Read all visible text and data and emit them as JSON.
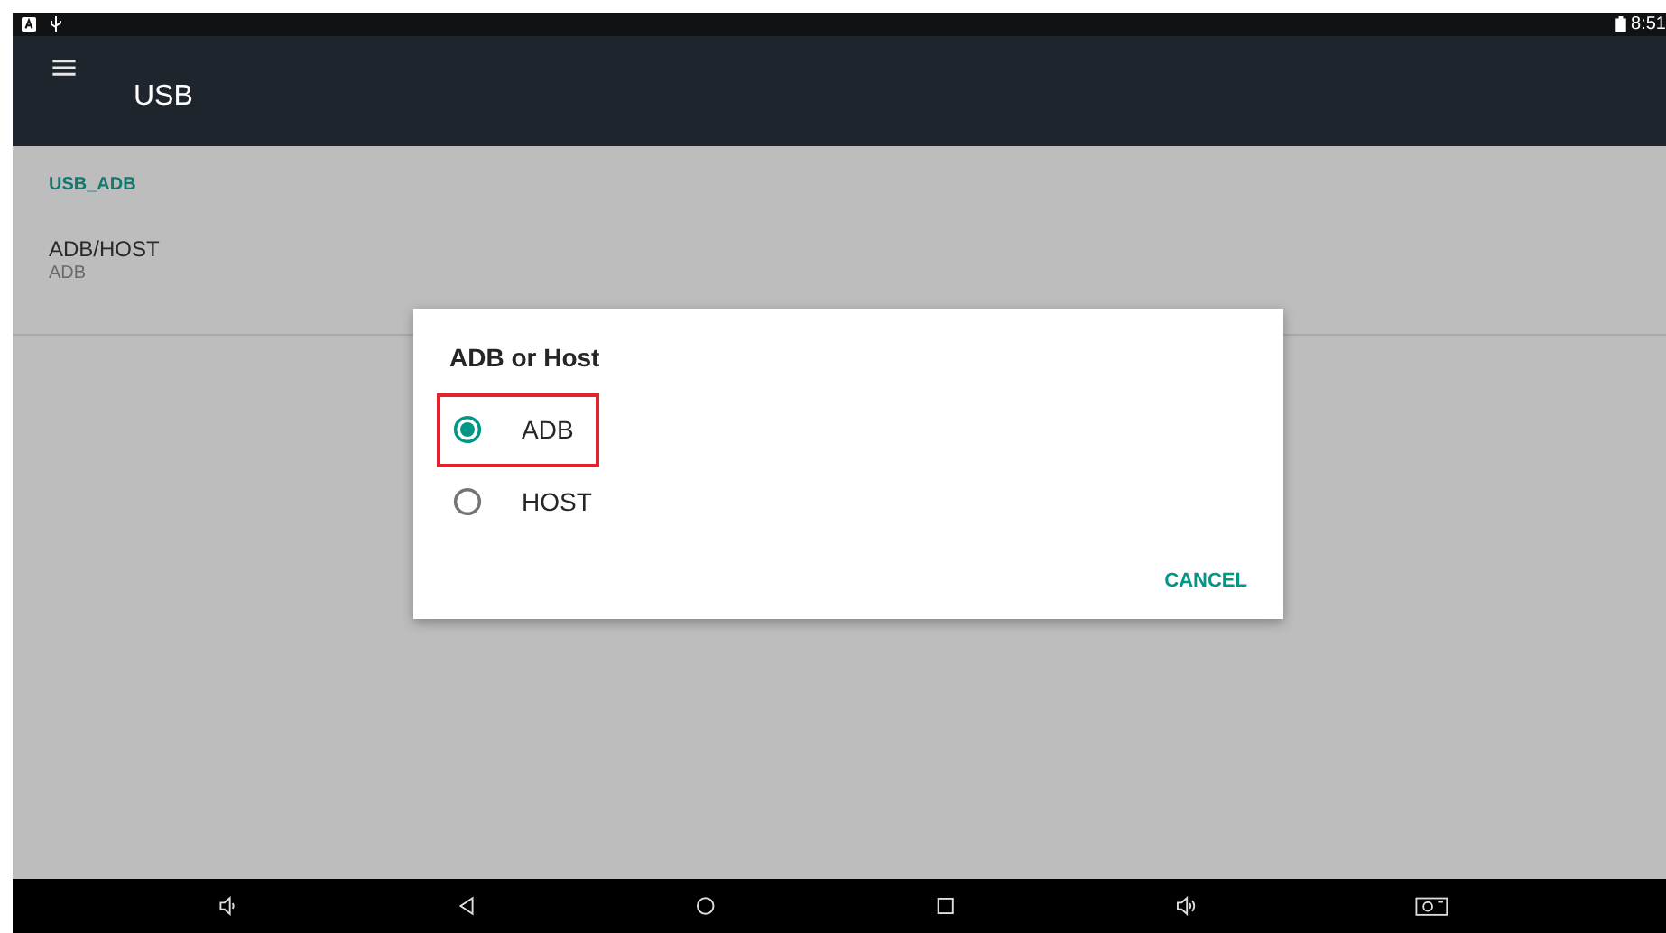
{
  "status_bar": {
    "time": "8:51"
  },
  "toolbar": {
    "title": "USB"
  },
  "category": "USB_ADB",
  "preference": {
    "title": "ADB/HOST",
    "summary": "ADB"
  },
  "dialog": {
    "title": "ADB or Host",
    "options": [
      {
        "label": "ADB",
        "selected": true,
        "highlighted": true
      },
      {
        "label": "HOST",
        "selected": false,
        "highlighted": false
      }
    ],
    "button": "CANCEL"
  }
}
